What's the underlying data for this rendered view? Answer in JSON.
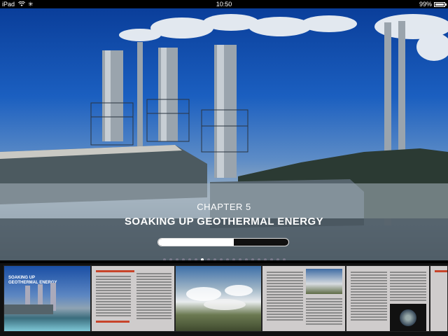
{
  "status_bar": {
    "device": "iPad",
    "time": "10:50",
    "battery": "99%",
    "battery_level": 0.99
  },
  "chapter": {
    "label": "CHAPTER 5",
    "title": "SOAKING UP GEOTHERMAL ENERGY",
    "progress": 0.58
  },
  "page_dots": {
    "count": 20,
    "active": 6
  },
  "thumbnails": [
    {
      "caption": "SOAKING UP GEOTHERMAL ENERGY"
    }
  ],
  "colors": {
    "sky_top": "#0a3e9a",
    "accent_red": "#c8442a",
    "page_paper": "#cfcccc"
  },
  "icons": [
    "wifi-icon",
    "activity-spinner-icon",
    "battery-icon"
  ]
}
